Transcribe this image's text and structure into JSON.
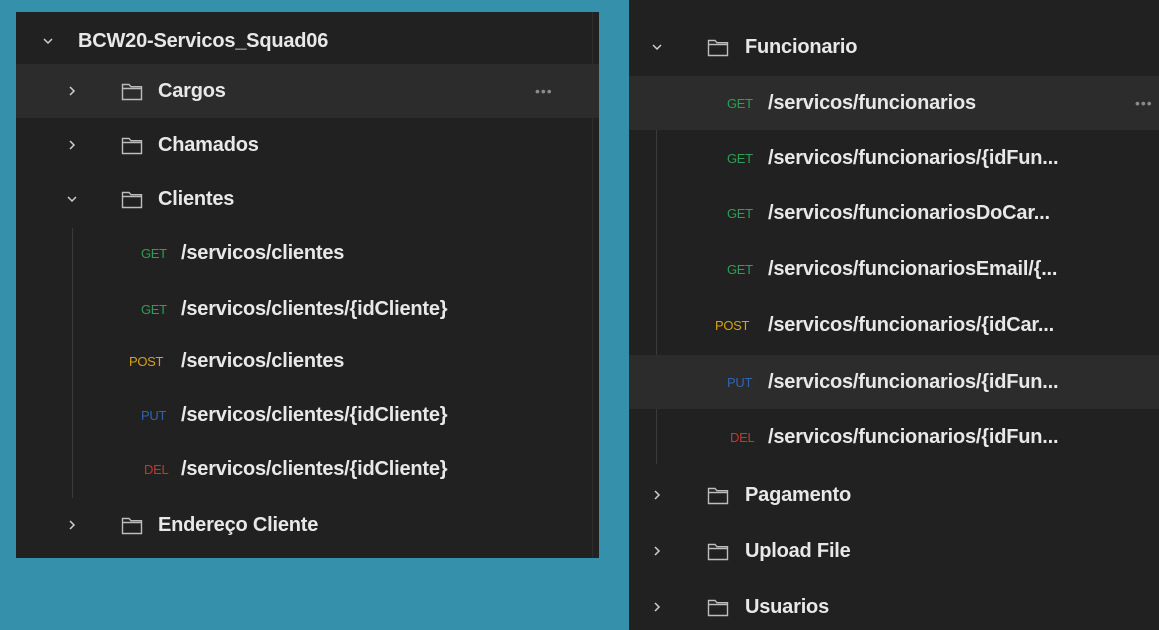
{
  "left_panel": {
    "collection": {
      "title": "BCW20-Servicos_Squad06"
    },
    "folders_top": [
      {
        "label": "Cargos",
        "more": "•••"
      },
      {
        "label": "Chamados"
      },
      {
        "label": "Clientes"
      }
    ],
    "requests": [
      {
        "method": "GET",
        "path": "/servicos/clientes"
      },
      {
        "method": "GET",
        "path": "/servicos/clientes/{idCliente}"
      },
      {
        "method": "POST",
        "path": "/servicos/clientes"
      },
      {
        "method": "PUT",
        "path": "/servicos/clientes/{idCliente}"
      },
      {
        "method": "DEL",
        "path": "/servicos/clientes/{idCliente}"
      }
    ],
    "folders_bottom": [
      {
        "label": "Endereço Cliente"
      }
    ]
  },
  "right_panel": {
    "folder": {
      "label": "Funcionario"
    },
    "requests": [
      {
        "method": "GET",
        "path": "/servicos/funcionarios",
        "more": "•••"
      },
      {
        "method": "GET",
        "path": "/servicos/funcionarios/{idFun..."
      },
      {
        "method": "GET",
        "path": "/servicos/funcionariosDoCar..."
      },
      {
        "method": "GET",
        "path": "/servicos/funcionariosEmail/{..."
      },
      {
        "method": "POST",
        "path": "/servicos/funcionarios/{idCar..."
      },
      {
        "method": "PUT",
        "path": "/servicos/funcionarios/{idFun..."
      },
      {
        "method": "DEL",
        "path": "/servicos/funcionarios/{idFun..."
      }
    ],
    "folders_bottom": [
      {
        "label": "Pagamento"
      },
      {
        "label": "Upload File"
      },
      {
        "label": "Usuarios"
      }
    ]
  },
  "colors": {
    "background": "#3590ab",
    "panel": "#212121",
    "GET": "#2e9e57",
    "POST": "#d9a214",
    "PUT": "#2f64b3",
    "DEL": "#c0392b"
  }
}
